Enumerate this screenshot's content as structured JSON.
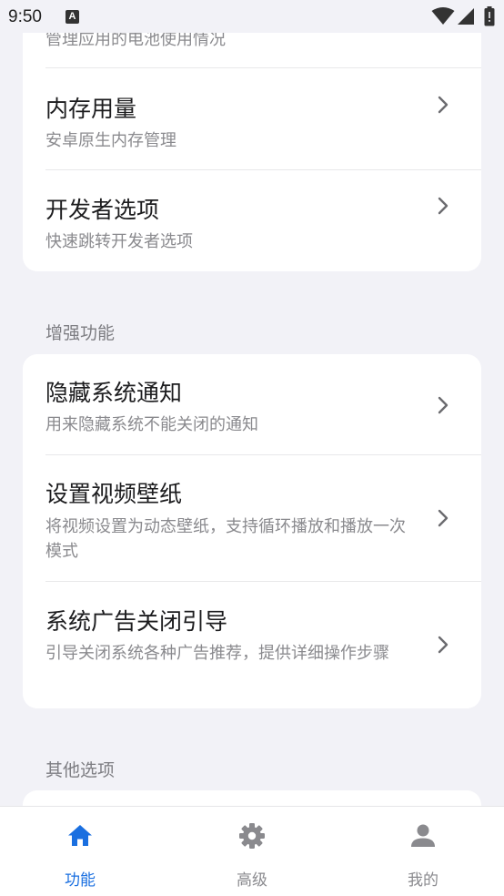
{
  "status_bar": {
    "time": "9:50",
    "notification_badge": "A"
  },
  "partial_top_item": {
    "subtitle": "管理应用的电池使用情况"
  },
  "card1": {
    "items": [
      {
        "title": "内存用量",
        "subtitle": "安卓原生内存管理"
      },
      {
        "title": "开发者选项",
        "subtitle": "快速跳转开发者选项"
      }
    ]
  },
  "sections": {
    "enhanced": "增强功能",
    "other": "其他选项"
  },
  "card2": {
    "items": [
      {
        "title": "隐藏系统通知",
        "subtitle": "用来隐藏系统不能关闭的通知"
      },
      {
        "title": "设置视频壁纸",
        "subtitle": "将视频设置为动态壁纸，支持循环播放和播放一次模式"
      },
      {
        "title": "系统广告关闭引导",
        "subtitle": "引导关闭系统各种广告推荐，提供详细操作步骤"
      }
    ]
  },
  "bottom_nav": {
    "items": [
      {
        "label": "功能",
        "icon": "home-icon",
        "active": true
      },
      {
        "label": "高级",
        "icon": "gear-icon",
        "active": false
      },
      {
        "label": "我的",
        "icon": "person-icon",
        "active": false
      }
    ],
    "active_color": "#1a6fe0",
    "inactive_color": "#8a8a8e"
  }
}
